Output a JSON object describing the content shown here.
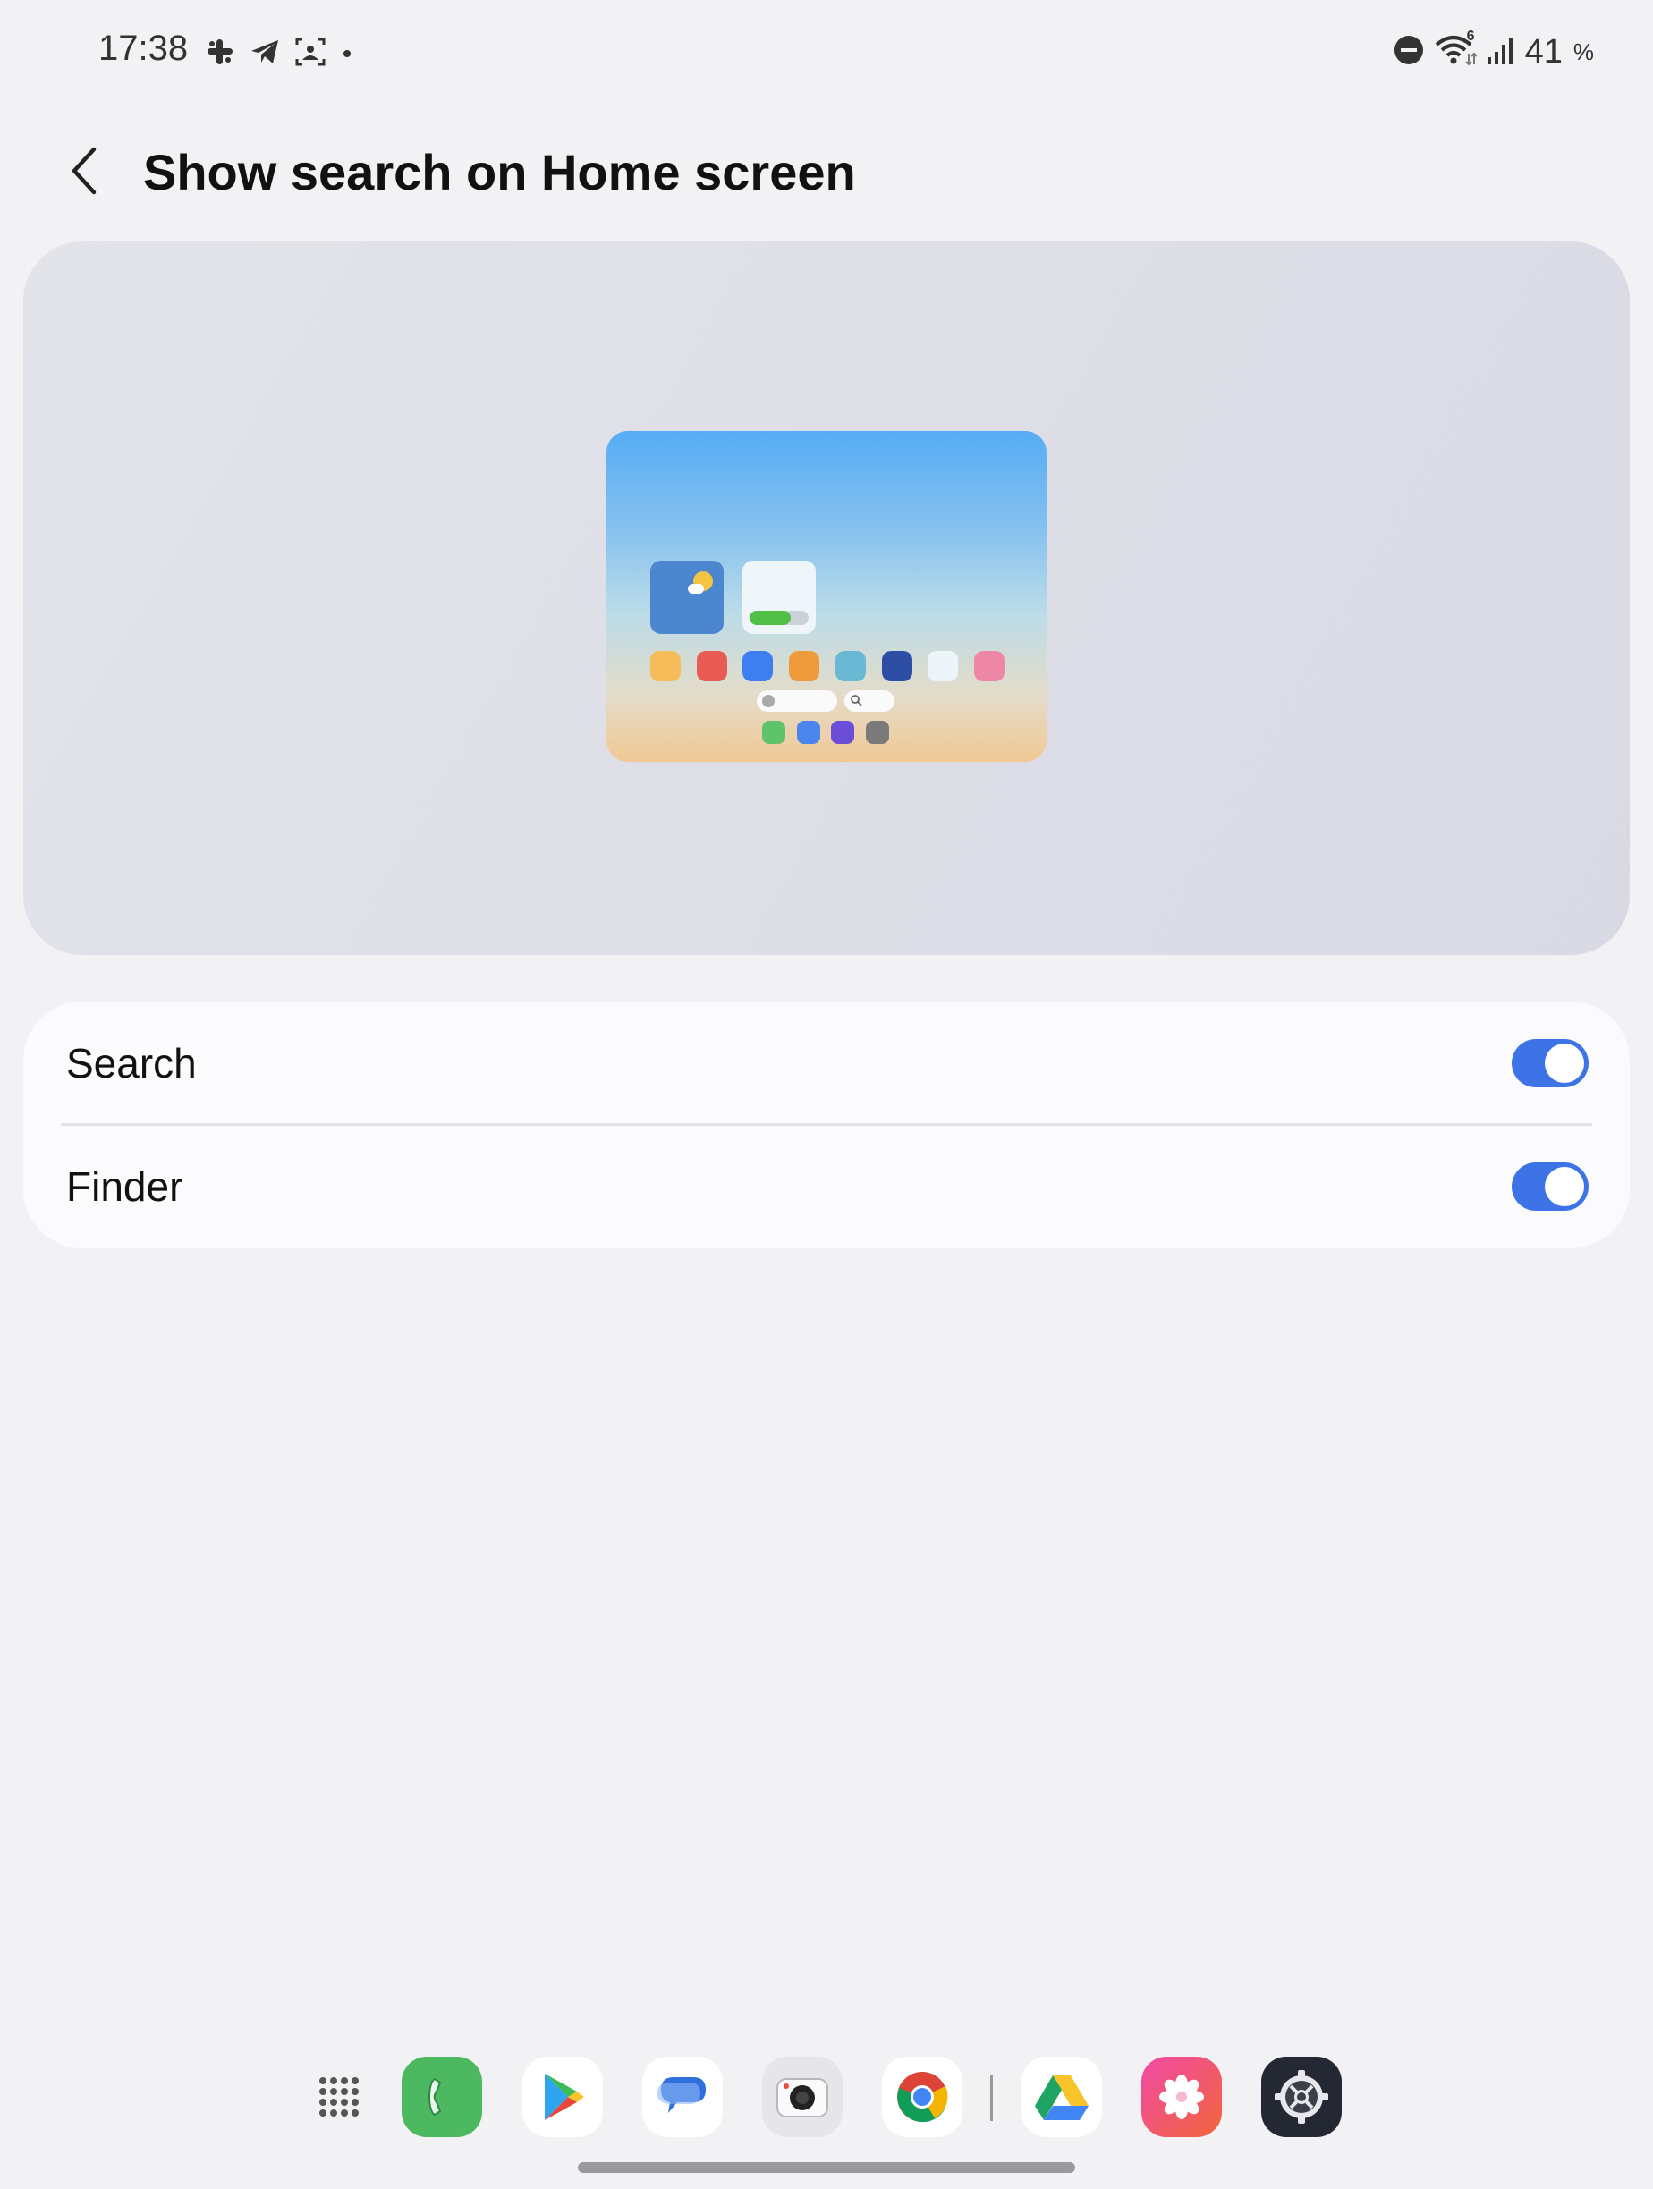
{
  "status_bar": {
    "time": "17:38",
    "left_icons": [
      "slack-icon",
      "telegram-icon",
      "screenshot-icon",
      "dot-icon"
    ],
    "right_icons": [
      "do-not-disturb-icon",
      "wifi-icon",
      "signal-icon"
    ],
    "wifi_badge": "6",
    "battery_value": "41",
    "battery_unit": "%"
  },
  "header": {
    "title": "Show search on Home screen",
    "back_icon": "chevron-left-icon"
  },
  "preview": {
    "battery_widget_level": 0.7,
    "app_colors": [
      "#f7bc5a",
      "#e85b52",
      "#3d7ef0",
      "#f09a3e",
      "#6ab9d4",
      "#2e4ea6",
      "#eef5fa",
      "#ee86a8"
    ],
    "dock_colors": [
      "#5fc36c",
      "#4a86ec",
      "#6a4ed8",
      "#7a7a7a"
    ]
  },
  "settings": [
    {
      "label": "Search",
      "enabled": true
    },
    {
      "label": "Finder",
      "enabled": true
    }
  ],
  "colors": {
    "accent": "#3e73e8",
    "background": "#f2f2f5",
    "card": "#fbfbfd"
  },
  "dock": {
    "apps": [
      "app-drawer-icon",
      "phone-icon",
      "play-store-icon",
      "messages-icon",
      "camera-icon",
      "chrome-icon",
      "google-drive-icon",
      "gallery-icon",
      "settings-icon"
    ]
  }
}
